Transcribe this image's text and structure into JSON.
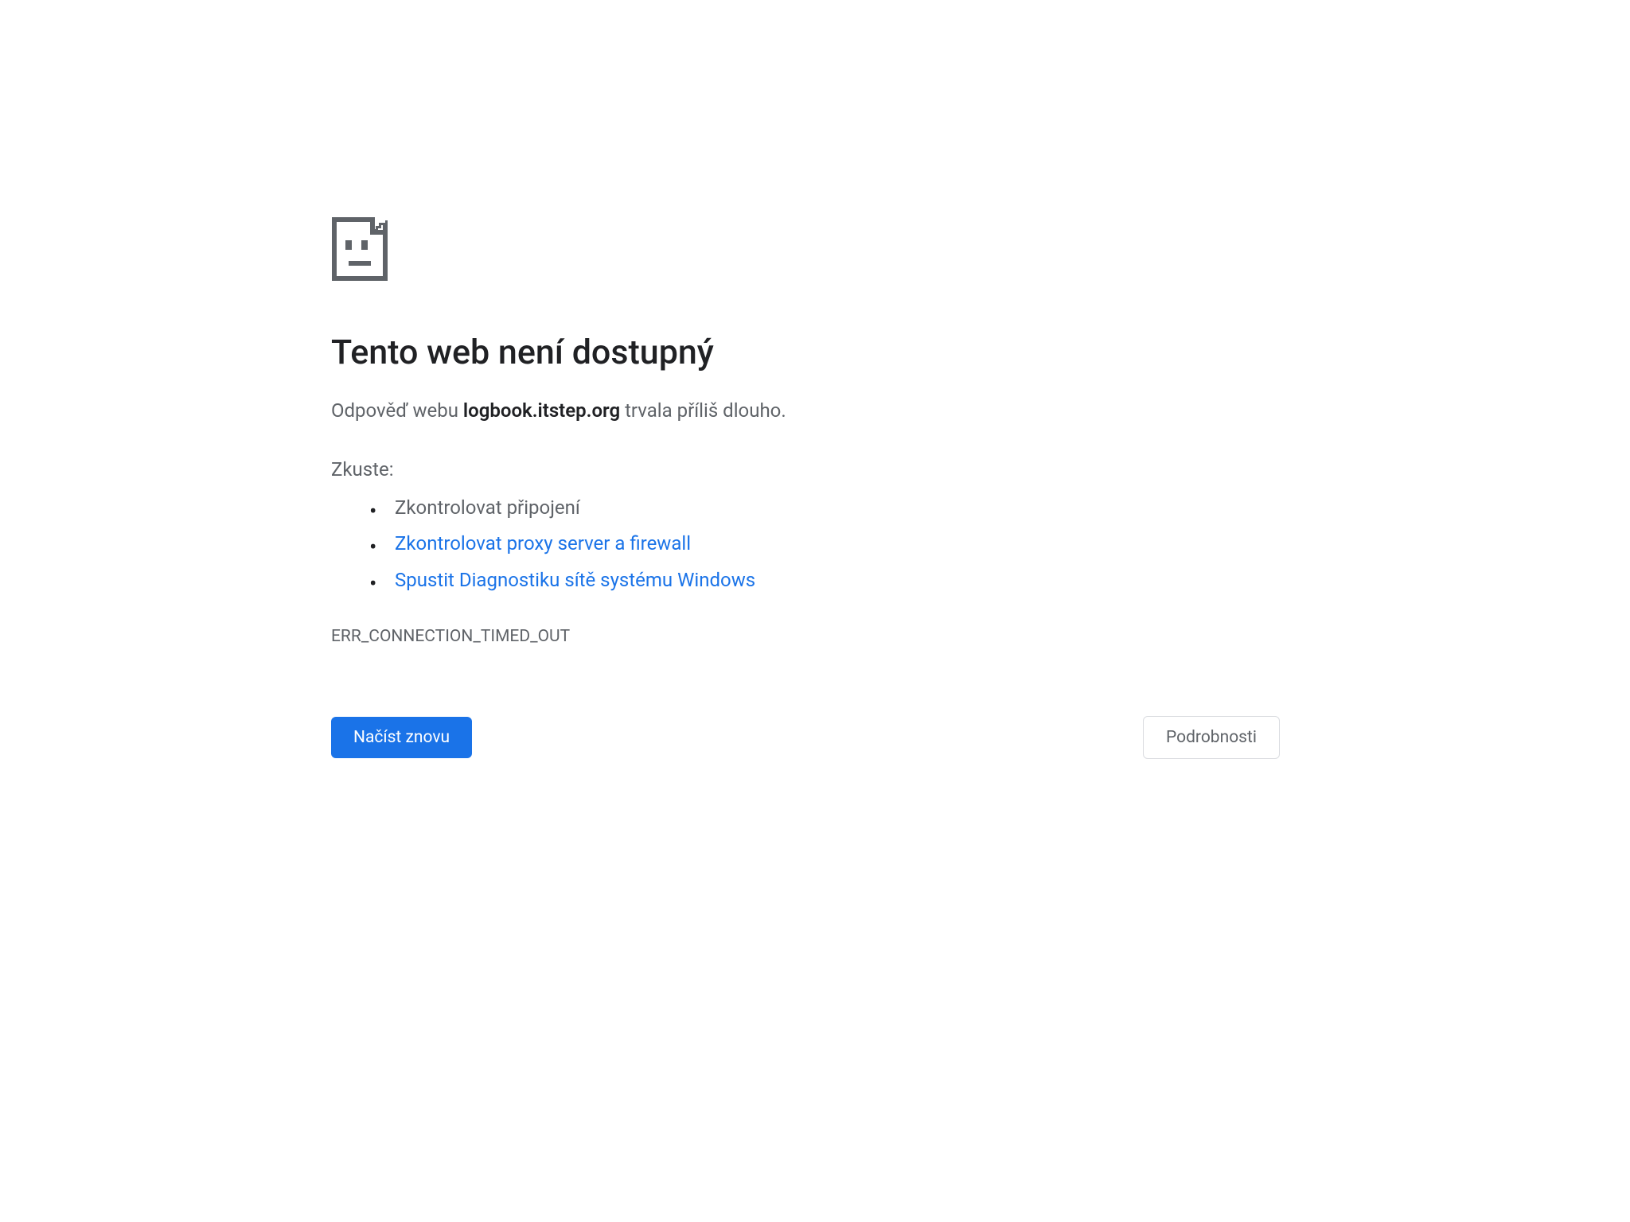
{
  "title": "Tento web není dostupný",
  "message_prefix": "Odpověď webu ",
  "message_host": "logbook.itstep.org",
  "message_suffix": " trvala příliš dlouho.",
  "try_label": "Zkuste:",
  "suggestions": {
    "item0": "Zkontrolovat připojení",
    "item1": "Zkontrolovat proxy server a firewall",
    "item2": "Spustit Diagnostiku sítě systému Windows"
  },
  "error_code": "ERR_CONNECTION_TIMED_OUT",
  "reload_button": "Načíst znovu",
  "details_button": "Podrobnosti"
}
